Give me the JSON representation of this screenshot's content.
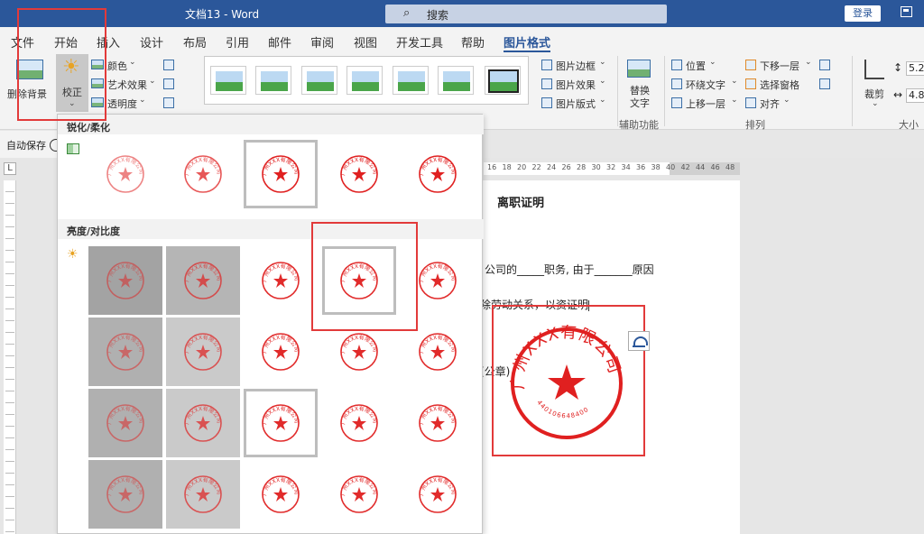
{
  "titlebar": {
    "title": "文档13  -  Word",
    "search_placeholder": "搜索",
    "login_label": "登录"
  },
  "tabs": [
    {
      "label": "文件"
    },
    {
      "label": "开始"
    },
    {
      "label": "插入"
    },
    {
      "label": "设计"
    },
    {
      "label": "布局"
    },
    {
      "label": "引用"
    },
    {
      "label": "邮件"
    },
    {
      "label": "审阅"
    },
    {
      "label": "视图"
    },
    {
      "label": "开发工具"
    },
    {
      "label": "帮助"
    },
    {
      "label": "图片格式"
    }
  ],
  "active_tab": "图片格式",
  "ribbon": {
    "remove_bg": "删除背景",
    "corrections": "校正",
    "color": "颜色",
    "artistic": "艺术效果",
    "transparency": "透明度",
    "picture_border": "图片边框",
    "picture_effects": "图片效果",
    "picture_layout": "图片版式",
    "alt_text_1": "替换",
    "alt_text_2": "文字",
    "accessibility": "辅助功能",
    "position": "位置",
    "wrap_text": "环绕文字",
    "bring_forward": "上移一层",
    "send_backward": "下移一层",
    "selection_pane": "选择窗格",
    "align": "对齐",
    "arrange": "排列",
    "crop": "裁剪",
    "size": "大小",
    "height_value": "5.2",
    "width_value": "4.8"
  },
  "autosave": {
    "label": "自动保存"
  },
  "gallery": {
    "sharpen_heading": "锐化/柔化",
    "brightness_heading": "亮度/对比度"
  },
  "document": {
    "title": "离职证明",
    "line1": "公司的_____职务, 由于_______原因",
    "line2": "除劳动关系，以资证明",
    "line3": "(公章)",
    "ruler_numbers": [
      "16",
      "18",
      "20",
      "22",
      "24",
      "26",
      "28",
      "30",
      "32",
      "34",
      "36",
      "38",
      "40",
      "42",
      "44",
      "46",
      "48"
    ]
  },
  "stamp": {
    "company_text": "广州XXX有限公司",
    "serial": "440106648400",
    "color": "#e02020"
  },
  "colors": {
    "accent": "#2b579a",
    "callout_red": "#e23a3a"
  }
}
